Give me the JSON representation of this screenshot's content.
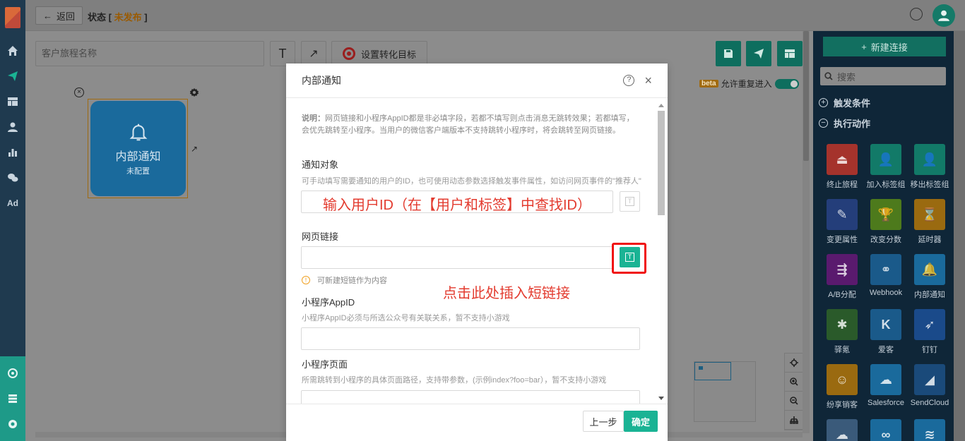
{
  "header": {
    "back_label": "返回",
    "status_prefix": "状态 [",
    "status_value": "未发布",
    "status_suffix": "]"
  },
  "toolbar": {
    "journey_name_placeholder": "客户旅程名称",
    "text_tool": "T",
    "arrow_tool": "↗",
    "goal_label": "设置转化目标",
    "beta_badge": "beta",
    "repeat_entry_label": "允许重复进入"
  },
  "canvas": {
    "node_title": "内部通知",
    "node_subtitle": "未配置",
    "node_remove": "×"
  },
  "right_panel": {
    "new_connection": "新建连接",
    "search_placeholder": "搜索",
    "section_trigger": "触发条件",
    "section_actions": "执行动作",
    "actions": [
      {
        "label": "终止旅程",
        "color": "#a5332c",
        "icon": "stop-icon",
        "glyph": "⏏"
      },
      {
        "label": "加入标签组",
        "color": "#127a68",
        "icon": "add-user-icon",
        "glyph": "👤"
      },
      {
        "label": "移出标签组",
        "color": "#127a68",
        "icon": "remove-user-icon",
        "glyph": "👤"
      },
      {
        "label": "变更属性",
        "color": "#243e7a",
        "icon": "edit-icon",
        "glyph": "✎"
      },
      {
        "label": "改变分数",
        "color": "#4d7a1c",
        "icon": "trophy-icon",
        "glyph": "🏆"
      },
      {
        "label": "延时器",
        "color": "#9a6a10",
        "icon": "hourglass-icon",
        "glyph": "⌛"
      },
      {
        "label": "A/B分配",
        "color": "#5a1a6e",
        "icon": "split-icon",
        "glyph": "⇶"
      },
      {
        "label": "Webhook",
        "color": "#1a5a8a",
        "icon": "webhook-icon",
        "glyph": "⚭"
      },
      {
        "label": "内部通知",
        "color": "#1a6a9c",
        "icon": "bell-icon",
        "glyph": "🔔"
      },
      {
        "label": "驿氪",
        "color": "#2a5a2a",
        "icon": "spider-icon",
        "glyph": "✱"
      },
      {
        "label": "爱客",
        "color": "#1a5a8a",
        "icon": "k-icon",
        "glyph": "K"
      },
      {
        "label": "钉钉",
        "color": "#1a4a8a",
        "icon": "dingtalk-icon",
        "glyph": "➶"
      },
      {
        "label": "纷享销客",
        "color": "#9a6a10",
        "icon": "robot-icon",
        "glyph": "☺"
      },
      {
        "label": "Salesforce",
        "color": "#1a6a9c",
        "icon": "cloud-icon",
        "glyph": "☁"
      },
      {
        "label": "SendCloud",
        "color": "#1a4a7a",
        "icon": "sendcloud-icon",
        "glyph": "◢"
      },
      {
        "label": "",
        "color": "#3a5a7a",
        "icon": "cloud-sync-icon",
        "glyph": "☁"
      },
      {
        "label": "",
        "color": "#1a6a9c",
        "icon": "link-icon",
        "glyph": "∞"
      },
      {
        "label": "",
        "color": "#1a6a9c",
        "icon": "brand-icon",
        "glyph": "≋"
      }
    ]
  },
  "modal": {
    "title": "内部通知",
    "help": "?",
    "close": "×",
    "note_lead": "说明：",
    "note_body": "网页链接和小程序AppID都是非必填字段，若都不填写则点击消息无跳转效果；若都填写，会优先跳转至小程序。当用户的微信客户端版本不支持跳转小程序时，将会跳转至网页链接。",
    "target_label": "通知对象",
    "target_help": "可手动填写需要通知的用户的ID，也可使用动态参数选择触发事件属性，如访问网页事件的\"推荐人\"",
    "target_annotation": "输入用户ID（在【用户和标签】中查找ID）",
    "url_label": "网页链接",
    "url_annotation": "点击此处插入短链接",
    "url_tip": "可新建短链作为内容",
    "appid_label": "小程序AppID",
    "appid_help": "小程序AppID必须与所选公众号有关联关系，暂不支持小游戏",
    "page_label": "小程序页面",
    "page_help": "所需跳转到小程序的具体页面路径，支持带参数，(示例index?foo=bar），暂不支持小游戏",
    "t_glyph": "T",
    "prev_button": "上一步",
    "ok_button": "确定",
    "accent": "#1ab394",
    "annotation_color": "#e33b2f"
  }
}
